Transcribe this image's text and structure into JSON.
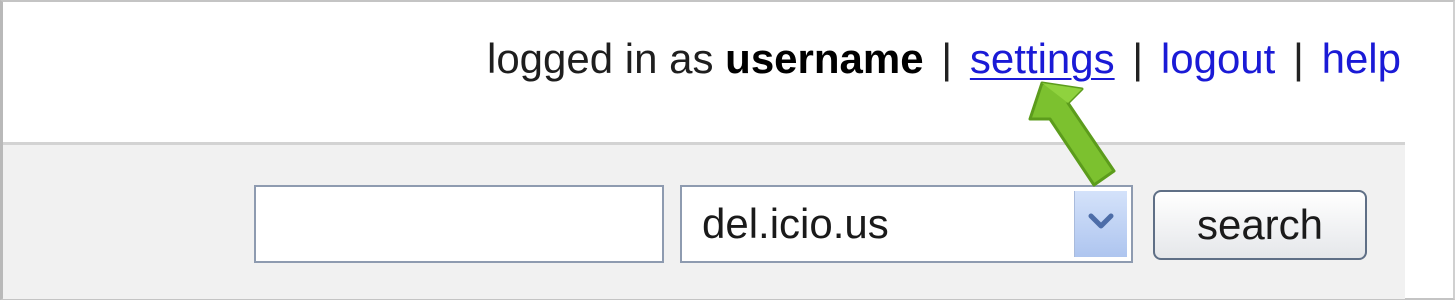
{
  "header": {
    "logged_in_prefix": "logged in as",
    "username": "username",
    "separator": "|",
    "links": {
      "settings": "settings",
      "logout": "logout",
      "help": "help"
    }
  },
  "search": {
    "input_value": "",
    "scope_selected": "del.icio.us",
    "button_label": "search"
  },
  "annotation": {
    "arrow_color": "#7cc12f",
    "arrow_target": "settings"
  },
  "colors": {
    "link": "#1a1ad6",
    "search_bar_bg": "#f1f1f1"
  }
}
